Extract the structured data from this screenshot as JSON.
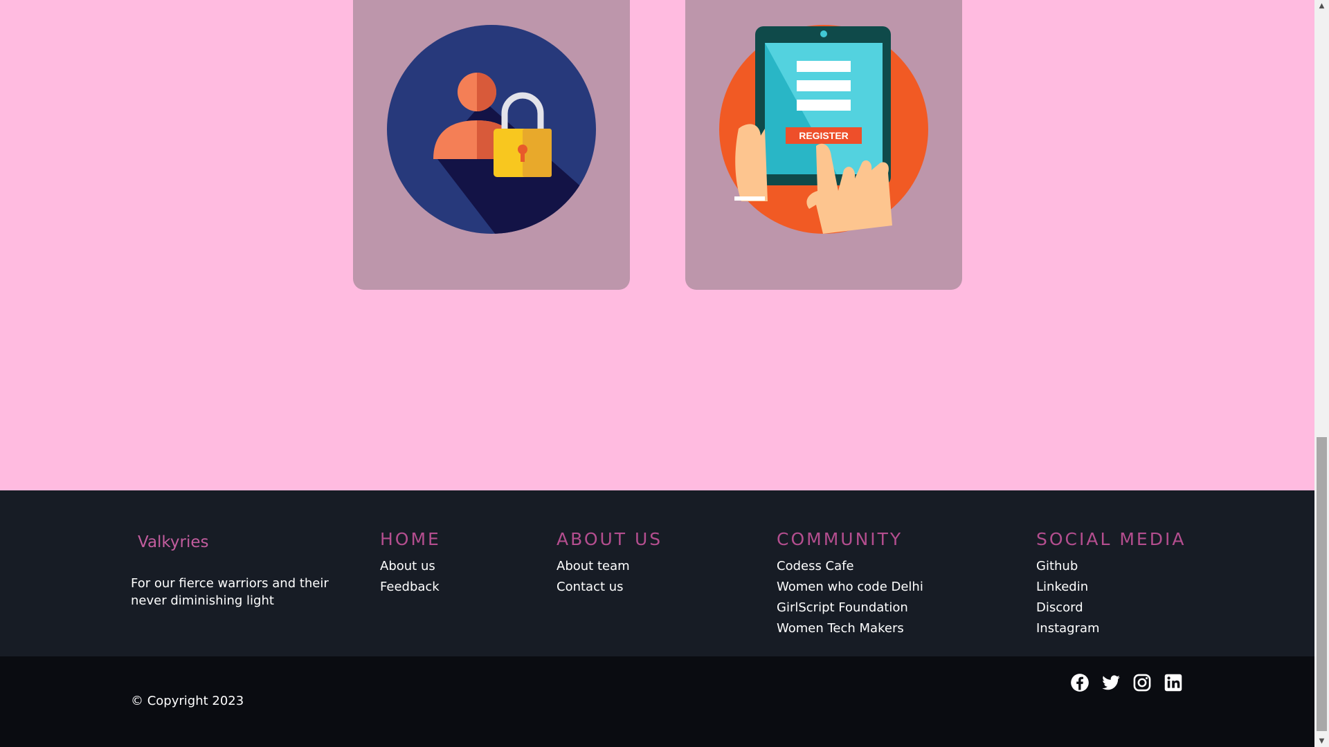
{
  "footer": {
    "brand": "Valkyries",
    "tagline": "For our fierce warriors and their never diminishing light",
    "columns": {
      "home": {
        "title": "HOME",
        "links": [
          "About us",
          "Feedback"
        ]
      },
      "about": {
        "title": "ABOUT US",
        "links": [
          "About team",
          "Contact us"
        ]
      },
      "community": {
        "title": "COMMUNITY",
        "links": [
          "Codess Cafe",
          "Women who code Delhi",
          "GirlScript Foundation",
          "Women Tech Makers"
        ]
      },
      "social": {
        "title": "SOCIAL MEDIA",
        "links": [
          "Github",
          "Linkedin",
          "Discord",
          "Instagram"
        ]
      }
    },
    "copyright": "© Copyright 2023",
    "icons": [
      "facebook-icon",
      "twitter-icon",
      "instagram-icon",
      "linkedin-icon"
    ]
  },
  "cards": {
    "register_label": "REGISTER"
  },
  "colors": {
    "page_bg": "#ffbbe0",
    "card_bg": "#bd96ab",
    "footer_bg": "#171c25",
    "bottom_bg": "#0a0c11",
    "accent": "#b44e8f"
  }
}
